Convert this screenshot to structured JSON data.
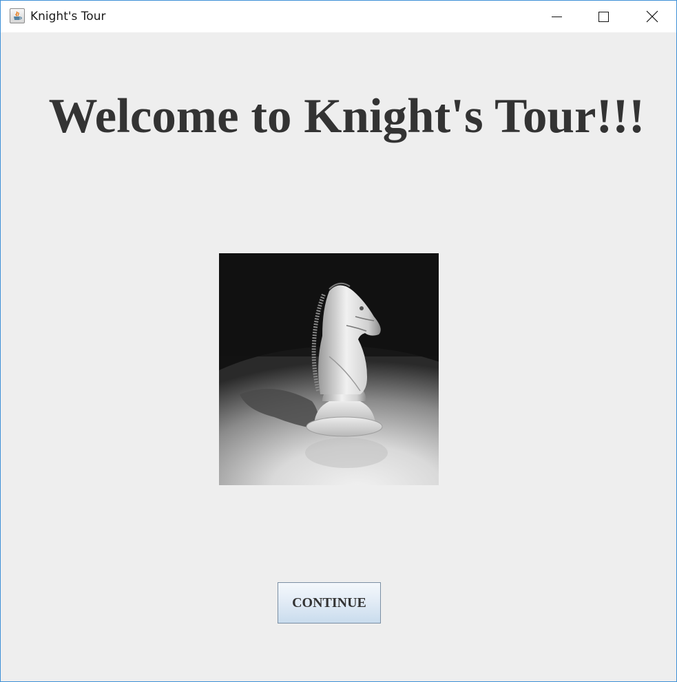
{
  "window": {
    "title": "Knight's Tour",
    "icon": "java-cup-icon",
    "controls": [
      "minimize-icon",
      "maximize-icon",
      "close-icon"
    ]
  },
  "main": {
    "heading": "Welcome to Knight's Tour!!!",
    "image": "chess-knight-image",
    "continue_label": "CONTINUE"
  },
  "colors": {
    "background": "#eeeeee",
    "titlebar": "#ffffff",
    "heading_text": "#333333",
    "window_border": "#3c8fd6",
    "button_gradient_top": "#f4f8fc",
    "button_gradient_bottom": "#c9dced"
  }
}
